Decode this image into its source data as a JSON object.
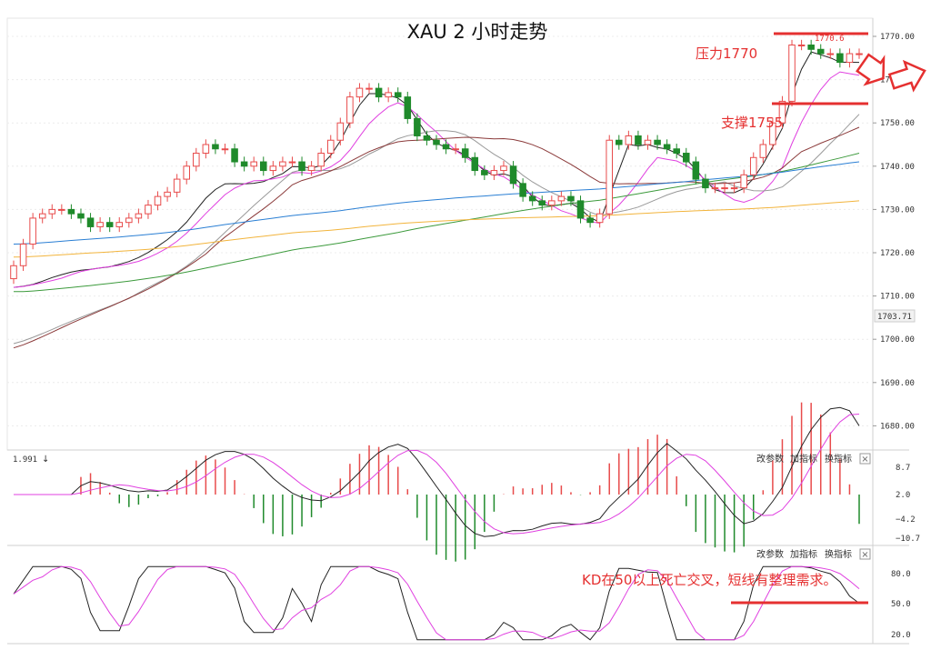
{
  "title": "XAU 2 小时走势",
  "annotations": {
    "resistance": "压力1770",
    "support": "支撑1755",
    "kd_note": "KD在50以上死亡交叉，短线有整理需求。",
    "high_label": "1770.6",
    "last_price": "1703.71"
  },
  "panel_controls": {
    "params": "改参数",
    "add": "加指标",
    "switch": "换指标",
    "close": "×"
  },
  "macd_value": "1.991",
  "colors": {
    "up": "#e84b4b",
    "down": "#1f8a2b",
    "ma_black": "#222222",
    "ma_magenta": "#e040e0",
    "ma_gray": "#999999",
    "ma_brown": "#8b3a3a",
    "ma_green": "#3c9a3c",
    "ma_blue": "#2a7fd4",
    "ma_orange": "#f2b43c",
    "annotation_red": "#e53030"
  },
  "chart_data": [
    {
      "type": "candlestick",
      "title": "XAU 2 小时走势",
      "y_ticks": [
        "1770.00",
        "1760.00",
        "1750.00",
        "1740.00",
        "1730.00",
        "1720.00",
        "1710.00",
        "1700.00",
        "1690.00",
        "1680.00"
      ],
      "ylim": [
        1676,
        1775
      ],
      "closes": [
        1717,
        1722,
        1728,
        1729,
        1730,
        1730,
        1729,
        1728,
        1726,
        1727,
        1726,
        1727,
        1728,
        1729,
        1731,
        1733,
        1734,
        1737,
        1740,
        1743,
        1745,
        1744,
        1744,
        1741,
        1740,
        1741,
        1739,
        1740,
        1741,
        1741,
        1739,
        1740,
        1743,
        1746,
        1750,
        1756,
        1758,
        1758,
        1756,
        1757,
        1756,
        1751,
        1747,
        1746,
        1745,
        1744,
        1744,
        1742,
        1739,
        1738,
        1739,
        1740,
        1736,
        1733,
        1732,
        1731,
        1732,
        1733,
        1732,
        1728,
        1727,
        1729,
        1746,
        1745,
        1747,
        1745,
        1746,
        1745,
        1744,
        1743,
        1741,
        1737,
        1735,
        1735,
        1735,
        1735,
        1738,
        1742,
        1745,
        1750,
        1755,
        1768,
        1768,
        1767,
        1766,
        1766,
        1764,
        1766,
        1766
      ],
      "moving_averages": [
        {
          "color": "black",
          "start": 1712,
          "end": 1764
        },
        {
          "color": "magenta",
          "start": 1712,
          "end": 1761
        },
        {
          "color": "gray",
          "start": 1699,
          "end": 1752
        },
        {
          "color": "brown",
          "start": 1698,
          "end": 1749
        },
        {
          "color": "green",
          "start": 1711,
          "end": 1743
        },
        {
          "color": "blue",
          "start": 1722,
          "end": 1741
        },
        {
          "color": "orange",
          "start": 1719,
          "end": 1732
        }
      ]
    },
    {
      "type": "macd",
      "y_ticks": [
        "8.7",
        "2.0",
        "−4.2",
        "−10.7"
      ]
    },
    {
      "type": "kd",
      "y_ticks": [
        "80.0",
        "50.0",
        "20.0"
      ]
    }
  ]
}
